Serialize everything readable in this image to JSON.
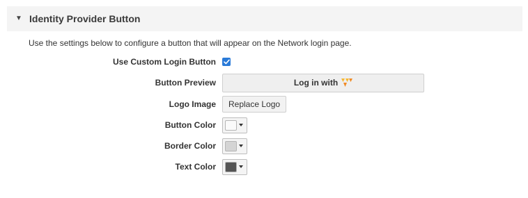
{
  "section": {
    "title": "Identity Provider Button",
    "caret": "▼"
  },
  "description": "Use the settings below to configure a button that will appear on the Network login page.",
  "fields": {
    "use_custom": {
      "label": "Use Custom Login Button",
      "checked": true
    },
    "preview": {
      "label": "Button Preview",
      "button_text": "Log in with",
      "logo_colors": [
        "#f7b731",
        "#f08a24"
      ]
    },
    "logo_image": {
      "label": "Logo Image",
      "button_text": "Replace Logo"
    },
    "button_color": {
      "label": "Button Color",
      "value": "#fafafa"
    },
    "border_color": {
      "label": "Border Color",
      "value": "#d4d4d4"
    },
    "text_color": {
      "label": "Text Color",
      "value": "#555555"
    }
  },
  "icons": {
    "caret": "caret-down-icon",
    "checkbox": "checkmark-icon",
    "logo": "provider-logo-icon",
    "dropdown": "dropdown-arrow-icon"
  }
}
